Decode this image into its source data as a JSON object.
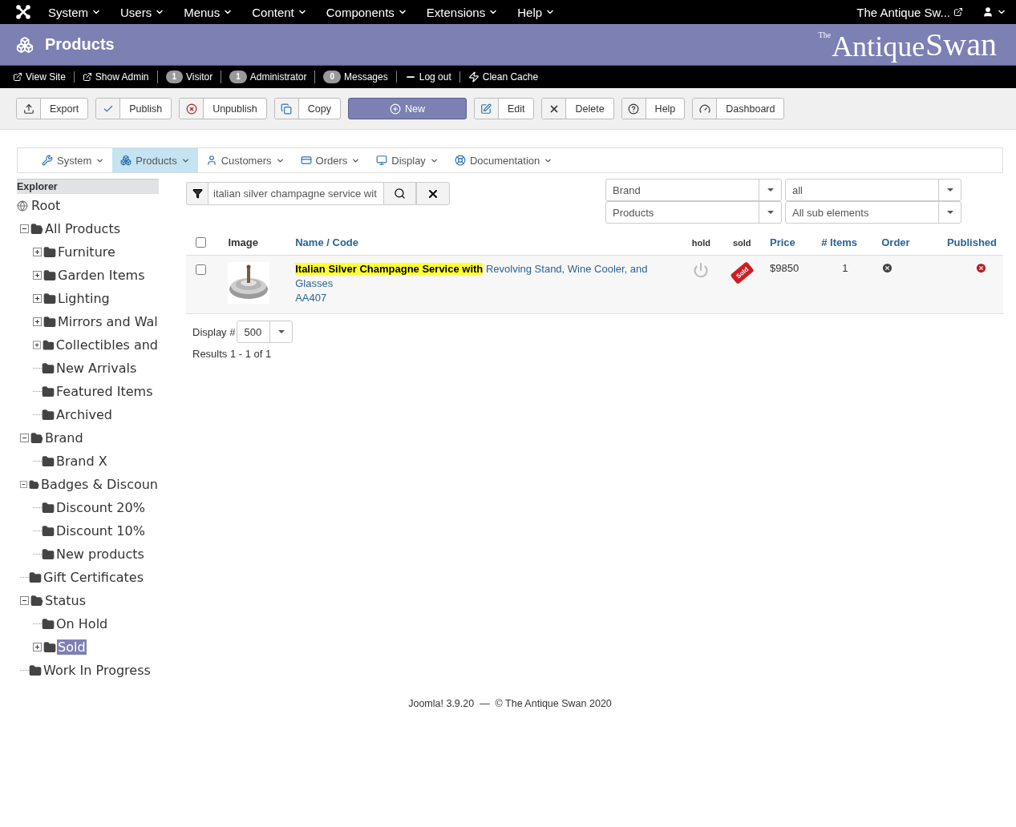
{
  "top_menu": [
    {
      "label": "System"
    },
    {
      "label": "Users"
    },
    {
      "label": "Menus"
    },
    {
      "label": "Content"
    },
    {
      "label": "Components"
    },
    {
      "label": "Extensions"
    },
    {
      "label": "Help"
    }
  ],
  "site_link": "The Antique Sw...",
  "header": {
    "title": "Products",
    "logo_small": "The",
    "logo_main": "Antique",
    "logo_second": "Swan"
  },
  "status_bar": [
    {
      "kind": "link",
      "label": "View Site"
    },
    {
      "kind": "link",
      "label": "Show Admin"
    },
    {
      "kind": "count",
      "count": "1",
      "label": "Visitor"
    },
    {
      "kind": "count",
      "count": "1",
      "label": "Administrator"
    },
    {
      "kind": "count",
      "count": "0",
      "label": "Messages"
    },
    {
      "kind": "logout",
      "label": "Log out"
    },
    {
      "kind": "cache",
      "label": "Clean Cache"
    }
  ],
  "toolbar": [
    {
      "label": "Export",
      "primary": false
    },
    {
      "label": "Publish",
      "primary": false
    },
    {
      "label": "Unpublish",
      "primary": false
    },
    {
      "label": "Copy",
      "primary": false
    },
    {
      "label": "New",
      "primary": true
    },
    {
      "label": "Edit",
      "primary": false
    },
    {
      "label": "Delete",
      "primary": false
    },
    {
      "label": "Help",
      "primary": false
    },
    {
      "label": "Dashboard",
      "primary": false
    }
  ],
  "submenu": [
    {
      "label": "System",
      "selected": false
    },
    {
      "label": "Products",
      "selected": true
    },
    {
      "label": "Customers",
      "selected": false
    },
    {
      "label": "Orders",
      "selected": false
    },
    {
      "label": "Display",
      "selected": false
    },
    {
      "label": "Documentation",
      "selected": false
    }
  ],
  "explorer": {
    "title": "Explorer",
    "root": "Root",
    "items": [
      {
        "label": "All Products",
        "kind": "branch",
        "expanded": true,
        "selected": false,
        "children": [
          {
            "label": "Furniture",
            "kind": "branch",
            "expanded": false,
            "selected": false
          },
          {
            "label": "Garden Items",
            "kind": "branch",
            "expanded": false,
            "selected": false
          },
          {
            "label": "Lighting",
            "kind": "branch",
            "expanded": false,
            "selected": false
          },
          {
            "label": "Mirrors and Wal",
            "kind": "branch",
            "expanded": false,
            "selected": false
          },
          {
            "label": "Collectibles and",
            "kind": "branch",
            "expanded": false,
            "selected": false
          },
          {
            "label": "New Arrivals",
            "kind": "leaf",
            "selected": false
          },
          {
            "label": "Featured Items",
            "kind": "leaf",
            "selected": false
          },
          {
            "label": "Archived",
            "kind": "leaf",
            "selected": false
          }
        ]
      },
      {
        "label": "Brand",
        "kind": "branch",
        "expanded": true,
        "selected": false,
        "children": [
          {
            "label": "Brand X",
            "kind": "leaf",
            "selected": false
          }
        ]
      },
      {
        "label": "Badges & Discoun",
        "kind": "branch",
        "expanded": true,
        "selected": false,
        "children": [
          {
            "label": "Discount 20%",
            "kind": "leaf",
            "selected": false
          },
          {
            "label": "Discount 10%",
            "kind": "leaf",
            "selected": false
          },
          {
            "label": "New products",
            "kind": "leaf",
            "selected": false
          }
        ]
      },
      {
        "label": "Gift Certificates",
        "kind": "leaf",
        "selected": false
      },
      {
        "label": "Status",
        "kind": "branch",
        "expanded": true,
        "selected": false,
        "children": [
          {
            "label": "On Hold",
            "kind": "leaf",
            "selected": false
          },
          {
            "label": "Sold",
            "kind": "branch",
            "expanded": false,
            "selected": true
          }
        ]
      },
      {
        "label": "Work In Progress",
        "kind": "leaf",
        "selected": false
      }
    ]
  },
  "search": {
    "value": "italian silver champagne service wit"
  },
  "filters": [
    {
      "value": "Brand"
    },
    {
      "value": "all"
    },
    {
      "value": "Products"
    },
    {
      "value": "All sub elements"
    }
  ],
  "table": {
    "all_checked": false,
    "columns": {
      "image": "Image",
      "name": "Name",
      "separator": "/",
      "code": "Code",
      "hold": "hold",
      "sold": "sold",
      "price": "Price",
      "items": "# Items",
      "order": "Order",
      "published": "Published"
    },
    "rows": [
      {
        "checked": false,
        "name_match": "Italian Silver Champagne Service with",
        "name_rest": "Revolving Stand, Wine Cooler, and Glasses",
        "code": "AA407",
        "on_hold": false,
        "sold": true,
        "sold_tag": "Sold",
        "price": "$9850",
        "items": "1",
        "published": false
      }
    ]
  },
  "display": {
    "label": "Display #",
    "value": "500"
  },
  "results": "Results 1 - 1 of 1",
  "footer": "Joomla! 3.9.20  —  © The Antique Swan 2020"
}
